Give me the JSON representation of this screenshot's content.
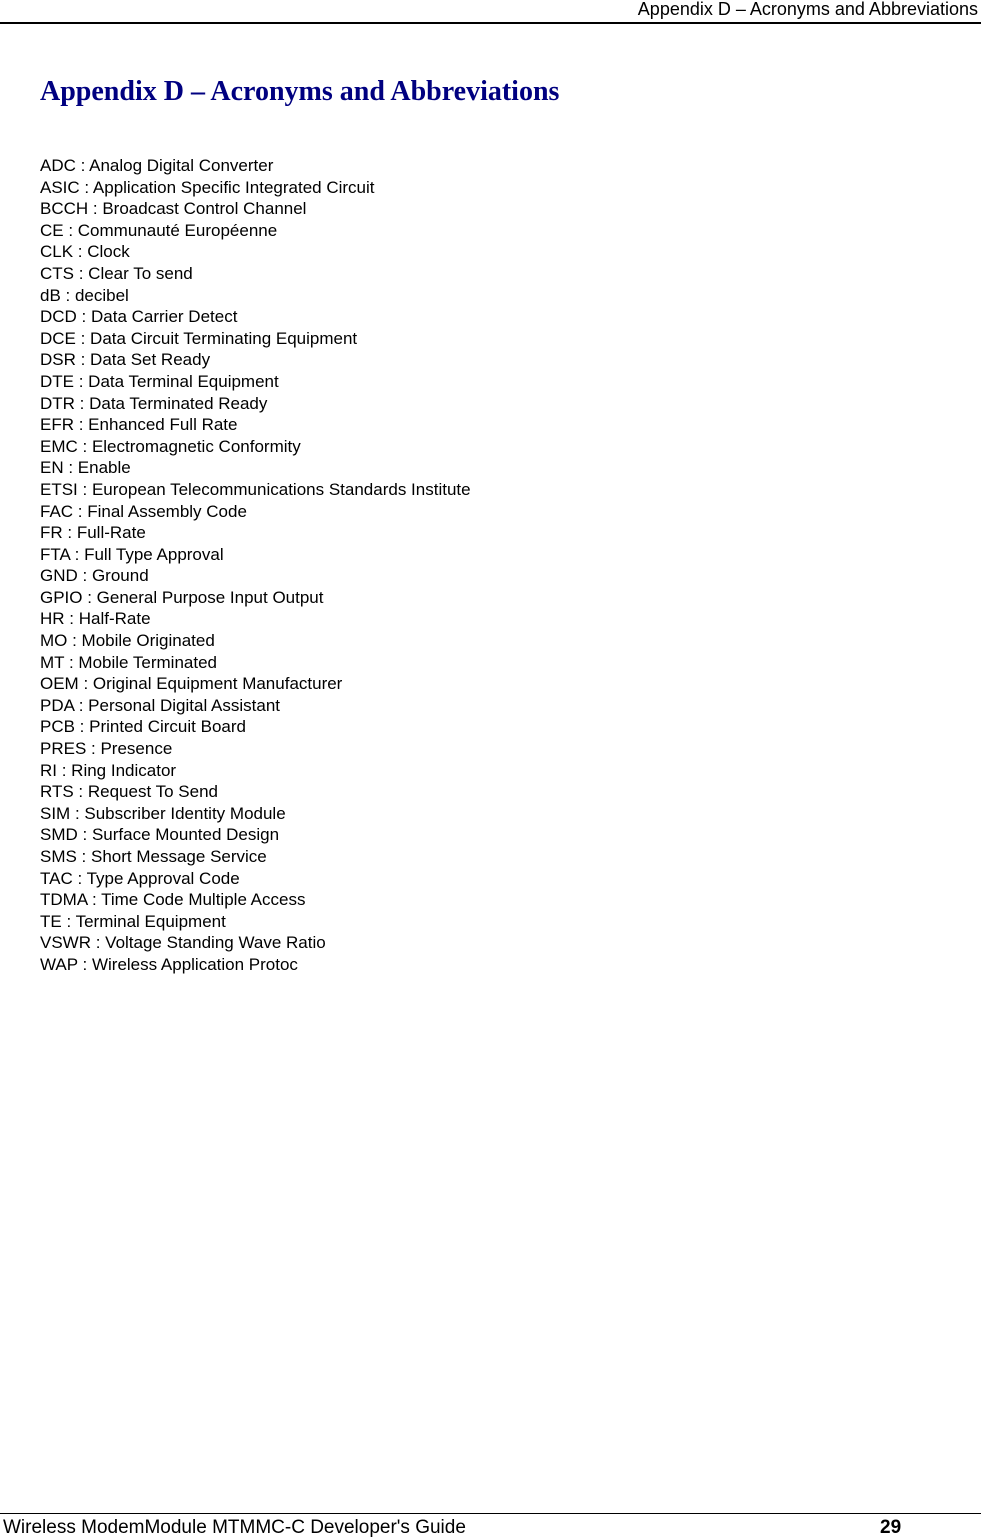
{
  "header": {
    "running_title": "Appendix D – Acronyms and Abbreviations"
  },
  "title": "Appendix D – Acronyms and Abbreviations",
  "acronyms": [
    "ADC : Analog Digital Converter",
    "ASIC : Application Specific Integrated Circuit",
    "BCCH : Broadcast Control Channel",
    "CE : Communauté Européenne",
    "CLK : Clock",
    "CTS : Clear To send",
    "dB : decibel",
    "DCD : Data Carrier Detect",
    "DCE : Data Circuit Terminating Equipment",
    "DSR : Data Set Ready",
    "DTE : Data Terminal Equipment",
    "DTR : Data Terminated Ready",
    "EFR : Enhanced Full Rate",
    "EMC : Electromagnetic Conformity",
    "EN : Enable",
    "ETSI : European Telecommunications Standards Institute",
    "FAC : Final Assembly Code",
    "FR : Full-Rate",
    "FTA : Full Type Approval",
    "GND : Ground",
    "GPIO : General Purpose Input Output",
    "HR : Half-Rate",
    "MO : Mobile Originated",
    "MT : Mobile Terminated",
    "OEM : Original Equipment Manufacturer",
    "PDA : Personal Digital Assistant",
    "PCB : Printed Circuit Board",
    "PRES : Presence",
    "RI : Ring Indicator",
    "RTS : Request To Send",
    "SIM : Subscriber Identity Module",
    "SMD : Surface Mounted Design",
    "SMS : Short Message Service",
    "TAC : Type Approval Code",
    "TDMA : Time Code Multiple Access",
    "TE : Terminal Equipment",
    "VSWR : Voltage Standing Wave Ratio",
    "WAP : Wireless Application Protoc"
  ],
  "footer": {
    "guide_title": "Wireless ModemModule MTMMC-C Developer's Guide",
    "page_number": "29"
  },
  "colors": {
    "title": "#000080",
    "text": "#000000"
  }
}
